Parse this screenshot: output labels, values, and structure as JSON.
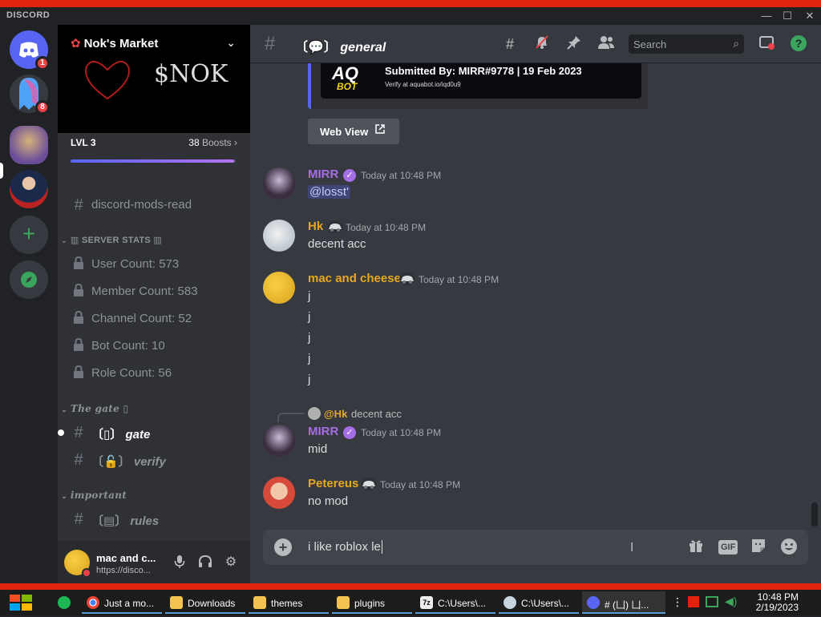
{
  "app": {
    "logo_text": "DISCORD"
  },
  "window": {
    "minimize": "—",
    "maximize": "☐",
    "close": "✕"
  },
  "guilds": [
    {
      "name": "home",
      "badge": "1"
    },
    {
      "name": "server-ghost",
      "badge": "8"
    },
    {
      "name": "server-cat",
      "badge": ""
    },
    {
      "name": "server-person",
      "badge": ""
    }
  ],
  "server": {
    "name": "Nok's Market",
    "banner_text": "$NOK",
    "level": "LVL 3",
    "boosts_count": "38",
    "boosts_label": "Boosts",
    "boost_progress": 0.99
  },
  "channels": {
    "top": {
      "label": "discord-mods-read"
    },
    "cat_stats": "SERVER STATS",
    "stats": [
      {
        "label": "User Count: 573"
      },
      {
        "label": "Member Count: 583"
      },
      {
        "label": "Channel Count: 52"
      },
      {
        "label": "Bot Count: 10"
      },
      {
        "label": "Role Count: 56"
      }
    ],
    "cat_gate": "The gate",
    "gate": {
      "label": "gate"
    },
    "verify": {
      "label": "verify"
    },
    "cat_important": "important",
    "rules": {
      "label": "rules"
    }
  },
  "user_panel": {
    "name": "mac and c...",
    "status": "https://disco..."
  },
  "header": {
    "channel_name": "general",
    "search_placeholder": "Search"
  },
  "embed": {
    "logo": "AQ",
    "logo_sub": "BOT",
    "submitted": "Submitted By: MIRR#9778 |  19 Feb 2023",
    "verify": "Verify at aquabot.io/iqd0u9",
    "web_view": "Web View"
  },
  "messages": [
    {
      "author": "MIRR",
      "color": "#a66ee4",
      "time": "Today at 10:48 PM",
      "lines": [
        "@losst'"
      ]
    },
    {
      "author": "Hk",
      "color": "#e7a821",
      "time": "Today at 10:48 PM",
      "lines": [
        "decent acc"
      ]
    },
    {
      "author": "mac and cheese",
      "color": "#e7a821",
      "time": "Today at 10:48 PM",
      "lines": [
        "j",
        "j",
        "j",
        "j",
        "j"
      ]
    },
    {
      "author": "MIRR",
      "color": "#a66ee4",
      "time": "Today at 10:48 PM",
      "lines": [
        "mid"
      ],
      "reply_to": "@Hk",
      "reply_text": "decent acc"
    },
    {
      "author": "Petereus",
      "color": "#e7a821",
      "time": "Today at 10:48 PM",
      "lines": [
        "no mod"
      ]
    }
  ],
  "composer": {
    "value": "i like roblox le",
    "gif_label": "GIF"
  },
  "taskbar": {
    "items": [
      {
        "label": "Just a mo..."
      },
      {
        "label": "Downloads"
      },
      {
        "label": "themes"
      },
      {
        "label": "plugins"
      },
      {
        "label": "C:\\Users\\..."
      },
      {
        "label": "C:\\Users\\..."
      },
      {
        "label": "# (凵) 凵..."
      }
    ],
    "time": "10:48 PM",
    "date": "2/19/2023"
  }
}
